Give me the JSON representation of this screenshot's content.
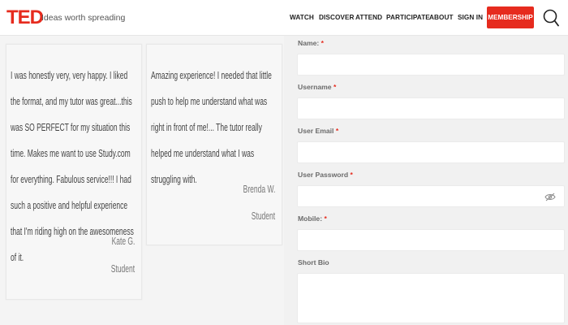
{
  "header": {
    "logo": "TED",
    "tagline": "Ideas worth spreading",
    "nav": [
      "WATCH",
      "DISCOVER",
      "ATTEND",
      "PARTICIPATE",
      "ABOUT",
      "SIGN IN"
    ],
    "membership": "MEMBERSHIP",
    "search_icon": "search-icon"
  },
  "testimonials": [
    {
      "quote": "I was honestly very, very happy. I liked the format, and my tutor was great...this was SO PERFECT for my situation this time. Makes me want to use Study.com for everything. Fabulous service!!! I had such a positive and helpful experience that I'm riding high on the awesomeness of it.",
      "author": "Kate G.",
      "role": "Student"
    },
    {
      "quote": "Amazing experience! I needed that little push to help me understand what was right in front of me!... The tutor really helped me understand what I was struggling with.",
      "author": "Brenda W.",
      "role": "Student"
    }
  ],
  "form": {
    "fields": [
      {
        "label": "Name:",
        "required": "*"
      },
      {
        "label": "Username",
        "required": "*"
      },
      {
        "label": "User Email",
        "required": "*"
      },
      {
        "label": "User Password",
        "required": "*"
      },
      {
        "label": "Mobile:",
        "required": "*"
      },
      {
        "label": "Short Bio",
        "required": ""
      }
    ]
  },
  "colors": {
    "brand_red": "#e62b1e",
    "required_red": "#e62b1e"
  }
}
